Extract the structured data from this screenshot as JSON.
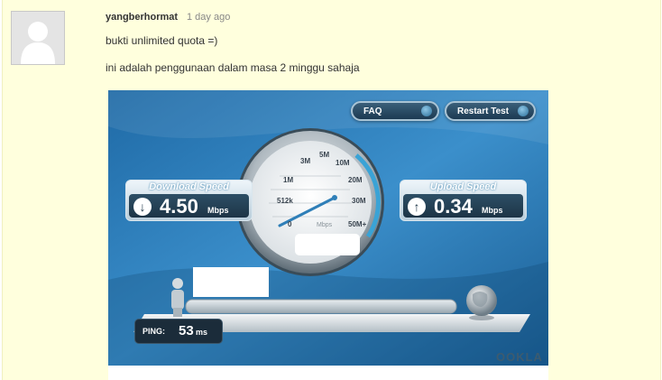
{
  "comment": {
    "author": "yangberhormat",
    "time_ago": "1 day ago",
    "lines": [
      "bukti unlimited quota =)",
      "ini adalah penggunaan dalam masa 2 minggu sahaja"
    ]
  },
  "speedtest": {
    "faq_label": "FAQ",
    "restart_label": "Restart Test",
    "download_title": "Download Speed",
    "download_value": "4.50",
    "download_unit": "Mbps",
    "upload_title": "Upload Speed",
    "upload_value": "0.34",
    "upload_unit": "Mbps",
    "gauge_ticks": [
      "0",
      "512k",
      "1M",
      "3M",
      "5M",
      "10M",
      "20M",
      "30M",
      "50M+"
    ],
    "gauge_unit": "Mbps",
    "ping_label": "PING:",
    "ping_value": "53",
    "ping_unit": "ms",
    "brand": "OOKLA",
    "colors": {
      "background_blue": "#2f7fb8",
      "panel_dark": "#1d3446",
      "accent_cyan": "#3aa3d6"
    }
  }
}
